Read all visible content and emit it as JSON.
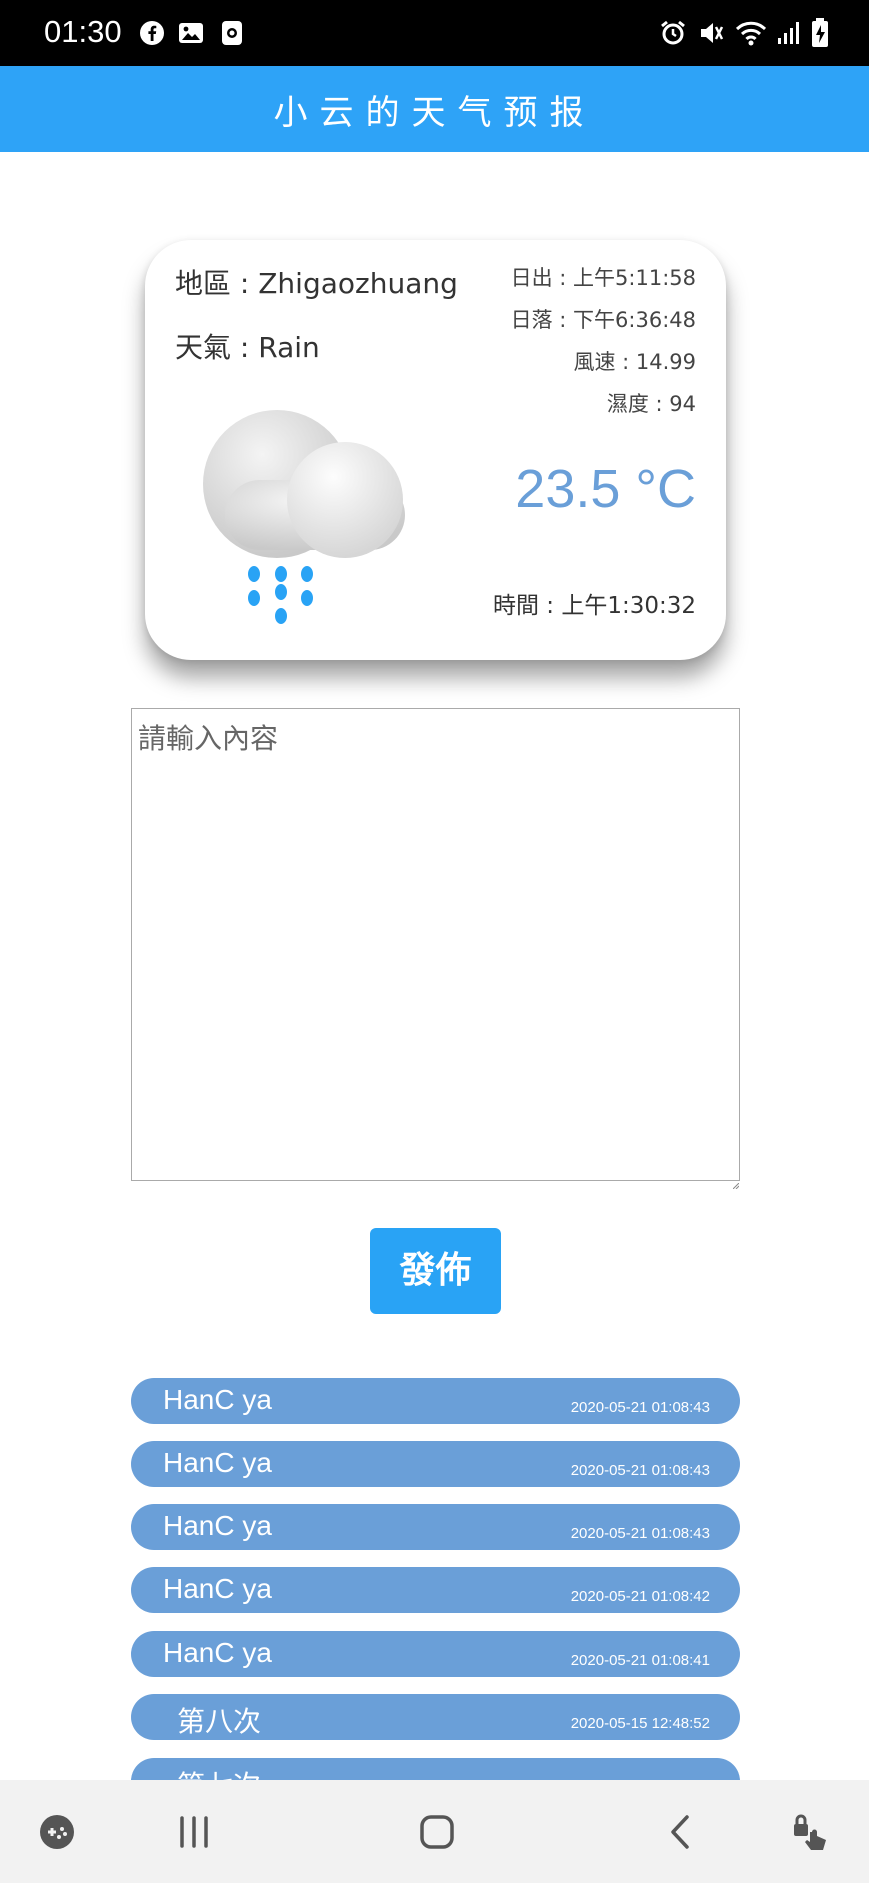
{
  "status_bar": {
    "time": "01:30",
    "left_icons": [
      "facebook-icon",
      "gallery-icon",
      "screen-record-icon"
    ],
    "right_icons": [
      "alarm-icon",
      "mute-icon",
      "wifi-icon",
      "signal-icon",
      "battery-icon"
    ]
  },
  "app_bar": {
    "title": "小云的天气预报",
    "color": "#2ea3f7"
  },
  "weather": {
    "region": "地區 : Zhigaozhuang",
    "condition": "天氣 : Rain",
    "sunrise": "日出 : 上午5:11:58",
    "sunset": "日落 : 下午6:36:48",
    "wind_speed": "風速 : 14.99",
    "humidity": "濕度 : 94",
    "temperature": "23.5 °C",
    "time": "時間 : 上午1:30:32",
    "icon": "rain-cloud-icon",
    "temp_color": "#6a9fd8"
  },
  "composer": {
    "placeholder": "請輸入內容",
    "value": ""
  },
  "publish": {
    "label": "發佈",
    "color": "#29a3f5"
  },
  "posts": [
    {
      "author": "HanC ya",
      "date": "2020-05-21 01:08:43"
    },
    {
      "author": "HanC ya",
      "date": "2020-05-21 01:08:43"
    },
    {
      "author": "HanC ya",
      "date": "2020-05-21 01:08:43"
    },
    {
      "author": "HanC ya",
      "date": "2020-05-21 01:08:42"
    },
    {
      "author": "HanC ya",
      "date": "2020-05-21 01:08:41"
    },
    {
      "author": "第八次",
      "date": "2020-05-15 12:48:52"
    },
    {
      "author": "第七次",
      "date": ""
    }
  ],
  "post_color": "#6a9fd8",
  "nav_bar": {
    "buttons": [
      "game-launcher-icon",
      "recent-apps-icon",
      "home-icon",
      "back-icon",
      "lock-touch-icon"
    ]
  }
}
